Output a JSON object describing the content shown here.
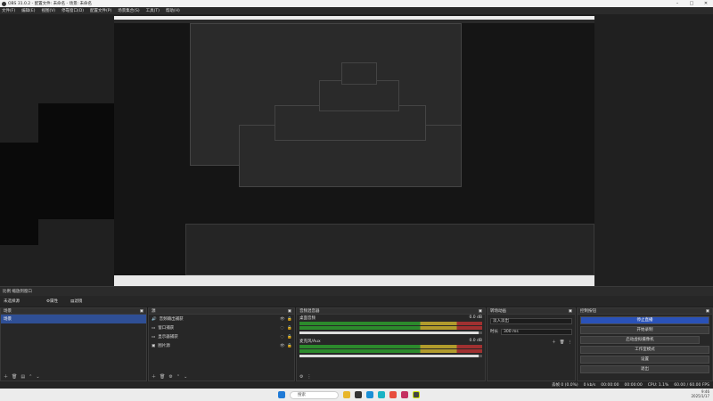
{
  "window": {
    "title": "OBS 31.0.2 - 配置文件: 未命名 - 场景: 未命名"
  },
  "menu": [
    "文件(F)",
    "编辑(E)",
    "视图(V)",
    "停靠窗口(D)",
    "配置文件(P)",
    "场景集合(S)",
    "工具(T)",
    "帮助(H)"
  ],
  "ruler": {
    "zoom": "比例 缩放到窗口"
  },
  "modebar": {
    "none": "未选择源",
    "properties": "属性",
    "filters": "滤镜"
  },
  "docks": {
    "scenes": {
      "title": "场景",
      "items": [
        "场景"
      ]
    },
    "sources": {
      "title": "源",
      "items": [
        {
          "label": "音频输出捕获",
          "icon": "speaker-icon"
        },
        {
          "label": "窗口捕获",
          "icon": "window-icon"
        },
        {
          "label": "显示器捕获",
          "icon": "monitor-icon"
        },
        {
          "label": "图片源",
          "icon": "image-icon"
        }
      ]
    },
    "mixer": {
      "title": "音频混音器",
      "channels": [
        {
          "name": "桌面音频",
          "db": "0.0 dB"
        },
        {
          "name": "麦克风/Aux",
          "db": "0.0 dB"
        }
      ]
    },
    "transitions": {
      "title": "转场动画",
      "type": "淡入淡出",
      "duration_label": "时长",
      "duration": "300 ms"
    },
    "controls": {
      "title": "控制按钮",
      "buttons": [
        "停止直播",
        "开始录制",
        "启动虚拟摄像机",
        "工作室模式",
        "设置",
        "退出"
      ]
    }
  },
  "status": {
    "frames": "丢帧 0 (0.0%)",
    "kbps": "0 kb/s",
    "time1": "00:00:00",
    "time2": "00:00:00",
    "cpu": "CPU: 1.1%",
    "fps": "60.00 / 60.00 FPS"
  },
  "taskbar": {
    "search": "搜索",
    "time": "9:46",
    "date": "2025/1/17"
  },
  "colors": {
    "accent": "#2f4f95",
    "meter_green": "#2c8a2c",
    "meter_yellow": "#b19b2c",
    "meter_red": "#a03030"
  }
}
